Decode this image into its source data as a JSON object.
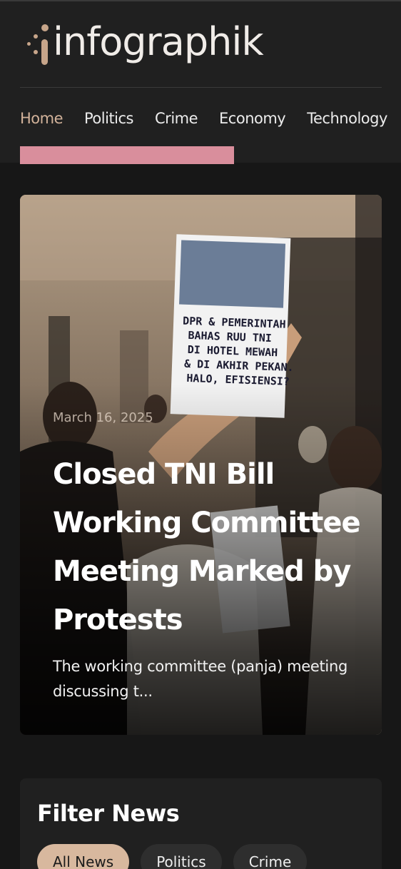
{
  "brand": {
    "name": "infographik",
    "accent_color": "#d2b29a",
    "bar_color": "#d98e9c"
  },
  "nav": {
    "items": [
      {
        "label": "Home",
        "active": true
      },
      {
        "label": "Politics",
        "active": false
      },
      {
        "label": "Crime",
        "active": false
      },
      {
        "label": "Economy",
        "active": false
      },
      {
        "label": "Technology",
        "active": false
      }
    ]
  },
  "hero": {
    "date": "March 16, 2025",
    "title": "Closed TNI Bill Working Committee Meeting Marked by Protests",
    "excerpt": "The working committee (panja) meeting discussing t...",
    "sign_text": "DPR & PEMERINTAH BAHAS RUU TNI DI HOTEL MEWAH & DI AKHIR PEKAN. HALO, EFISIENSI?"
  },
  "filter": {
    "title": "Filter News",
    "chips": [
      {
        "label": "All News",
        "active": true
      },
      {
        "label": "Politics",
        "active": false
      },
      {
        "label": "Crime",
        "active": false
      }
    ]
  }
}
